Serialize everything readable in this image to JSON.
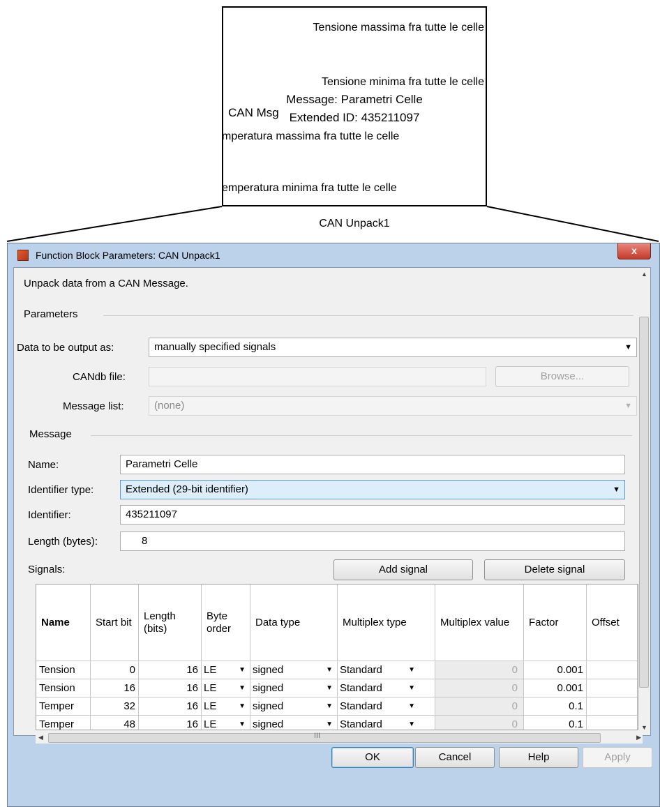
{
  "block": {
    "outputs": [
      "Tensione massima fra tutte le celle",
      "Tensione minima fra tutte le celle",
      "mperatura massima fra tutte le celle",
      "emperatura minima fra tutte le celle"
    ],
    "message_line": "Message: Parametri Celle",
    "id_line": "Extended ID: 435211097",
    "input_port": "CAN Msg",
    "name": "CAN Unpack1"
  },
  "dialog": {
    "title": "Function Block Parameters: CAN Unpack1",
    "close_label": "x",
    "description": "Unpack data from a CAN Message.",
    "parameters_group": "Parameters",
    "data_output_label": "Data to be output as:",
    "data_output_value": "manually specified signals",
    "candb_label": "CANdb file:",
    "candb_value": "",
    "browse_label": "Browse...",
    "message_list_label": "Message list:",
    "message_list_value": "(none)",
    "message_group": "Message",
    "name_label": "Name:",
    "name_value": "Parametri Celle",
    "identifier_type_label": "Identifier type:",
    "identifier_type_value": "Extended (29-bit identifier)",
    "identifier_label": "Identifier:",
    "identifier_value": "435211097",
    "length_label": "Length (bytes):",
    "length_value": "8",
    "signals_label": "Signals:",
    "add_signal": "Add signal",
    "delete_signal": "Delete signal",
    "table": {
      "headers": [
        "Name",
        "Start bit",
        "Length (bits)",
        "Byte order",
        "Data type",
        "Multiplex type",
        "Multiplex value",
        "Factor",
        "Offset"
      ],
      "rows": [
        {
          "name": "Tension",
          "start": "0",
          "length": "16",
          "order": "LE",
          "dtype": "signed",
          "mtype": "Standard",
          "mvalue": "0",
          "factor": "0.001",
          "offset": ""
        },
        {
          "name": "Tension",
          "start": "16",
          "length": "16",
          "order": "LE",
          "dtype": "signed",
          "mtype": "Standard",
          "mvalue": "0",
          "factor": "0.001",
          "offset": ""
        },
        {
          "name": "Temper",
          "start": "32",
          "length": "16",
          "order": "LE",
          "dtype": "signed",
          "mtype": "Standard",
          "mvalue": "0",
          "factor": "0.1",
          "offset": ""
        },
        {
          "name": "Temper",
          "start": "48",
          "length": "16",
          "order": "LE",
          "dtype": "signed",
          "mtype": "Standard",
          "mvalue": "0",
          "factor": "0.1",
          "offset": ""
        }
      ]
    },
    "scroll_grip": "III",
    "buttons": {
      "ok": "OK",
      "cancel": "Cancel",
      "help": "Help",
      "apply": "Apply"
    }
  }
}
